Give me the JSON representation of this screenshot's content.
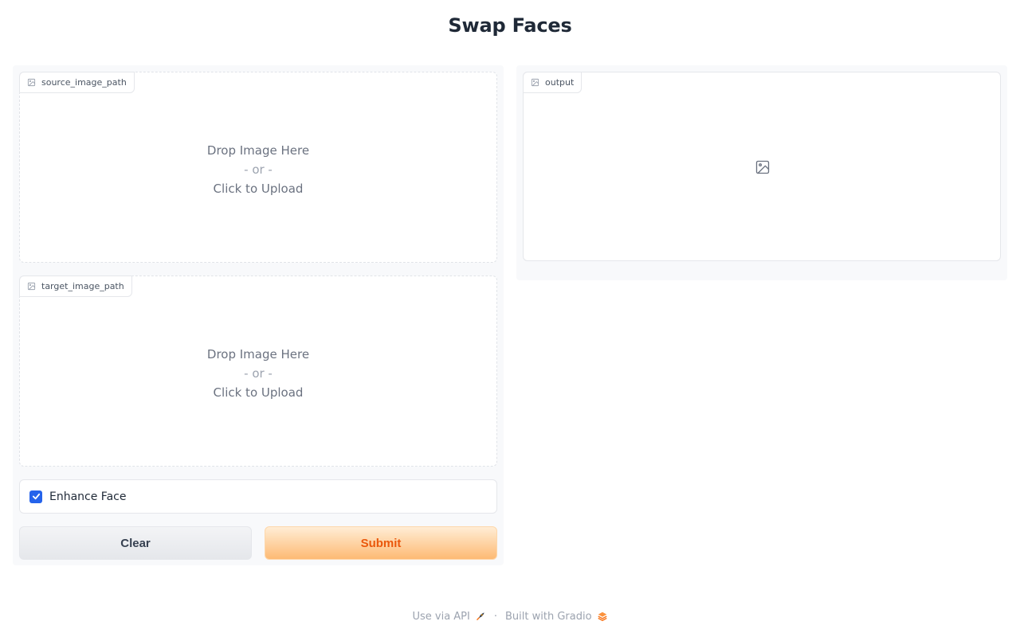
{
  "page": {
    "title": "Swap Faces"
  },
  "inputs": {
    "source": {
      "label": "source_image_path",
      "drop_line1": "Drop Image Here",
      "drop_or": "- or -",
      "drop_line2": "Click to Upload"
    },
    "target": {
      "label": "target_image_path",
      "drop_line1": "Drop Image Here",
      "drop_or": "- or -",
      "drop_line2": "Click to Upload"
    },
    "enhance_face": {
      "label": "Enhance Face",
      "checked": true
    }
  },
  "output": {
    "label": "output"
  },
  "buttons": {
    "clear": "Clear",
    "submit": "Submit"
  },
  "footer": {
    "api_link": "Use via API",
    "separator": "·",
    "built_with": "Built with Gradio"
  },
  "colors": {
    "accent": "#2563eb",
    "submit_text": "#ea580c",
    "submit_bg_start": "#ffedd5",
    "submit_bg_end": "#fdba74"
  },
  "icons": {
    "label_icon": "image-icon",
    "output_placeholder": "image-icon",
    "checkbox": "check-icon",
    "api": "rocket-icon",
    "gradio": "gradio-logo-icon"
  }
}
